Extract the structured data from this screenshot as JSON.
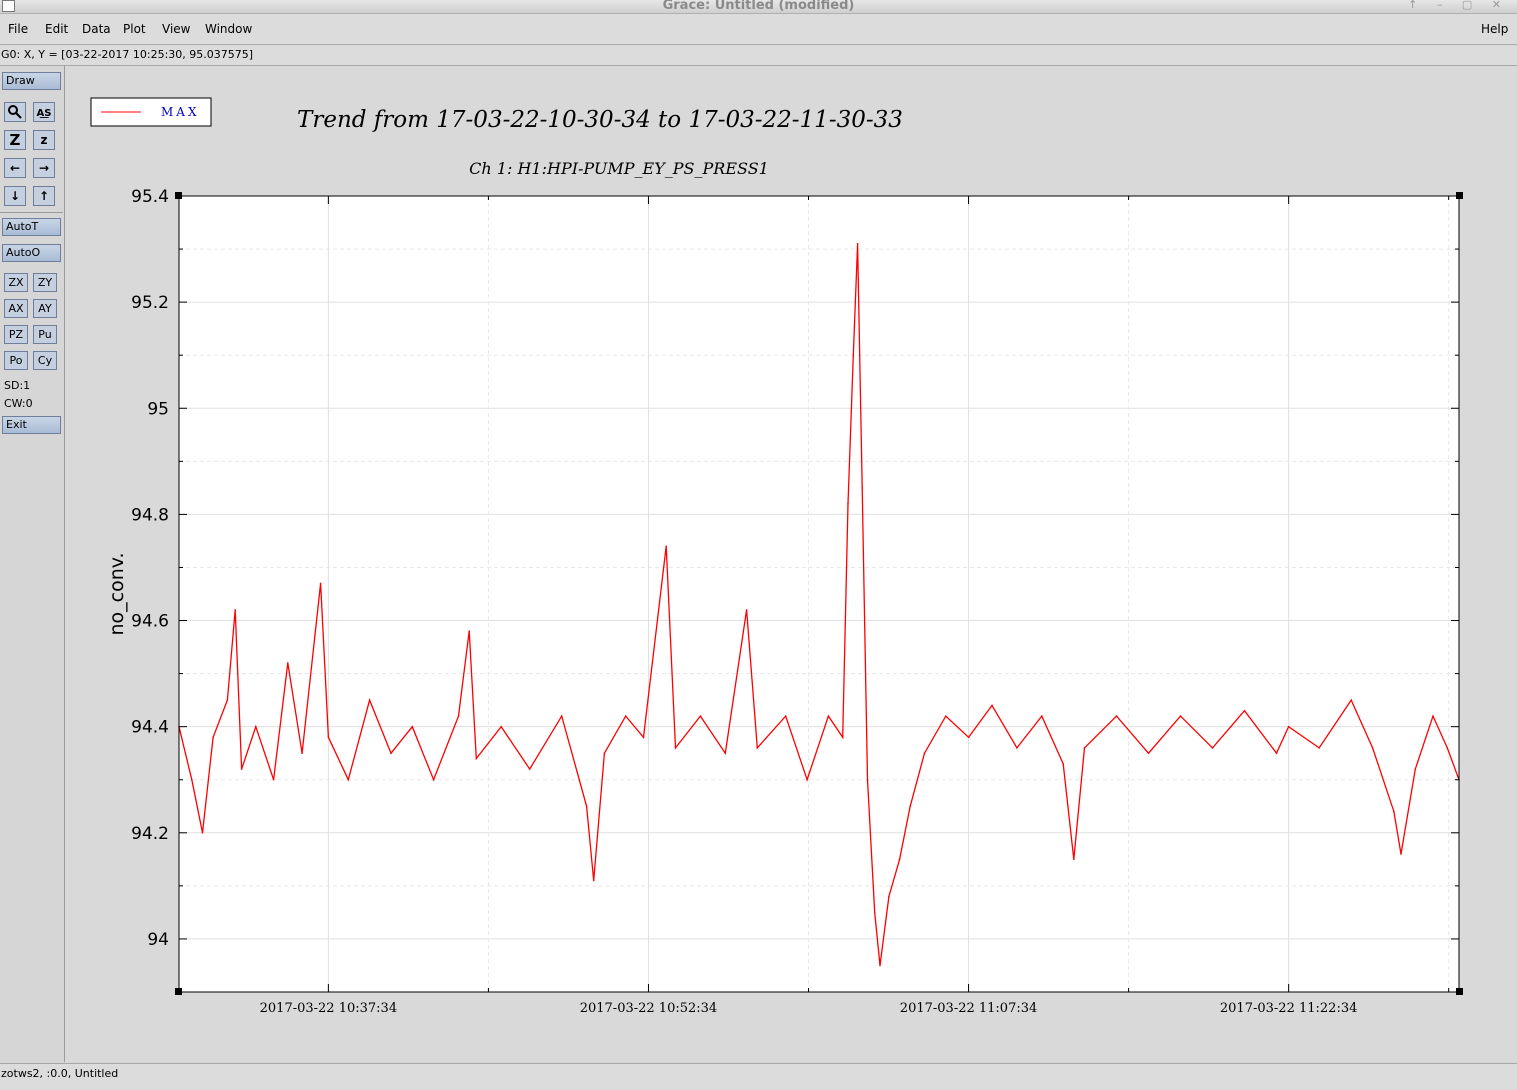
{
  "window": {
    "title": "Grace: Untitled (modified)"
  },
  "menu": [
    "File",
    "Edit",
    "Data",
    "Plot",
    "View",
    "Window"
  ],
  "help": "Help",
  "locator": "G0: X, Y = [03-22-2017 10:25:30, 95.037575]",
  "toolbox": {
    "draw": "Draw",
    "autot": "AutoT",
    "autoo": "AutoO",
    "small": [
      "ZX",
      "ZY",
      "AX",
      "AY",
      "PZ",
      "Pu",
      "Po",
      "Cy"
    ],
    "sd": "SD:1",
    "cw": "CW:0",
    "exit": "Exit"
  },
  "status": "zotws2, :0.0, Untitled",
  "chart_data": {
    "type": "line",
    "title": "Trend from 17-03-22-10-30-34 to 17-03-22-11-30-33",
    "subtitle": "Ch 1: H1:HPI-PUMP_EY_PS_PRESS1",
    "xlabel": "",
    "ylabel": "no_conv.",
    "xlim": [
      "2017-03-22 10:30:34",
      "2017-03-22 11:30:33"
    ],
    "ylim": [
      93.9,
      95.4
    ],
    "yticks": [
      94,
      94.2,
      94.4,
      94.6,
      94.8,
      95,
      95.2,
      95.4
    ],
    "xticks": [
      "2017-03-22 10:37:34",
      "2017-03-22 10:52:34",
      "2017-03-22 11:07:34",
      "2017-03-22 11:22:34"
    ],
    "grid": true,
    "legend_position": "top-left",
    "series": [
      {
        "name": "MAX",
        "color": "#ff0000",
        "points": [
          [
            "2017-03-22 10:30:34",
            94.4
          ],
          [
            "2017-03-22 10:31:10",
            94.3
          ],
          [
            "2017-03-22 10:31:40",
            94.2
          ],
          [
            "2017-03-22 10:32:10",
            94.38
          ],
          [
            "2017-03-22 10:32:50",
            94.45
          ],
          [
            "2017-03-22 10:33:12",
            94.62
          ],
          [
            "2017-03-22 10:33:30",
            94.32
          ],
          [
            "2017-03-22 10:34:10",
            94.4
          ],
          [
            "2017-03-22 10:35:00",
            94.3
          ],
          [
            "2017-03-22 10:35:40",
            94.52
          ],
          [
            "2017-03-22 10:36:20",
            94.35
          ],
          [
            "2017-03-22 10:37:12",
            94.67
          ],
          [
            "2017-03-22 10:37:34",
            94.38
          ],
          [
            "2017-03-22 10:38:30",
            94.3
          ],
          [
            "2017-03-22 10:39:30",
            94.45
          ],
          [
            "2017-03-22 10:40:30",
            94.35
          ],
          [
            "2017-03-22 10:41:30",
            94.4
          ],
          [
            "2017-03-22 10:42:30",
            94.3
          ],
          [
            "2017-03-22 10:43:40",
            94.42
          ],
          [
            "2017-03-22 10:44:10",
            94.58
          ],
          [
            "2017-03-22 10:44:30",
            94.34
          ],
          [
            "2017-03-22 10:45:40",
            94.4
          ],
          [
            "2017-03-22 10:47:00",
            94.32
          ],
          [
            "2017-03-22 10:48:30",
            94.42
          ],
          [
            "2017-03-22 10:49:40",
            94.25
          ],
          [
            "2017-03-22 10:50:00",
            94.11
          ],
          [
            "2017-03-22 10:50:30",
            94.35
          ],
          [
            "2017-03-22 10:51:30",
            94.42
          ],
          [
            "2017-03-22 10:52:20",
            94.38
          ],
          [
            "2017-03-22 10:53:24",
            94.74
          ],
          [
            "2017-03-22 10:53:50",
            94.36
          ],
          [
            "2017-03-22 10:55:00",
            94.42
          ],
          [
            "2017-03-22 10:56:10",
            94.35
          ],
          [
            "2017-03-22 10:57:10",
            94.62
          ],
          [
            "2017-03-22 10:57:40",
            94.36
          ],
          [
            "2017-03-22 10:59:00",
            94.42
          ],
          [
            "2017-03-22 11:00:00",
            94.3
          ],
          [
            "2017-03-22 11:01:00",
            94.42
          ],
          [
            "2017-03-22 11:01:40",
            94.38
          ],
          [
            "2017-03-22 11:01:55",
            94.82
          ],
          [
            "2017-03-22 11:02:10",
            95.1
          ],
          [
            "2017-03-22 11:02:22",
            95.31
          ],
          [
            "2017-03-22 11:02:35",
            94.85
          ],
          [
            "2017-03-22 11:02:50",
            94.3
          ],
          [
            "2017-03-22 11:03:10",
            94.05
          ],
          [
            "2017-03-22 11:03:25",
            93.95
          ],
          [
            "2017-03-22 11:03:50",
            94.08
          ],
          [
            "2017-03-22 11:04:20",
            94.15
          ],
          [
            "2017-03-22 11:04:50",
            94.25
          ],
          [
            "2017-03-22 11:05:30",
            94.35
          ],
          [
            "2017-03-22 11:06:30",
            94.42
          ],
          [
            "2017-03-22 11:07:34",
            94.38
          ],
          [
            "2017-03-22 11:08:40",
            94.44
          ],
          [
            "2017-03-22 11:09:50",
            94.36
          ],
          [
            "2017-03-22 11:11:00",
            94.42
          ],
          [
            "2017-03-22 11:12:00",
            94.33
          ],
          [
            "2017-03-22 11:12:30",
            94.15
          ],
          [
            "2017-03-22 11:13:00",
            94.36
          ],
          [
            "2017-03-22 11:14:30",
            94.42
          ],
          [
            "2017-03-22 11:16:00",
            94.35
          ],
          [
            "2017-03-22 11:17:30",
            94.42
          ],
          [
            "2017-03-22 11:19:00",
            94.36
          ],
          [
            "2017-03-22 11:20:30",
            94.43
          ],
          [
            "2017-03-22 11:22:00",
            94.35
          ],
          [
            "2017-03-22 11:22:34",
            94.4
          ],
          [
            "2017-03-22 11:24:00",
            94.36
          ],
          [
            "2017-03-22 11:25:30",
            94.45
          ],
          [
            "2017-03-22 11:26:30",
            94.36
          ],
          [
            "2017-03-22 11:27:30",
            94.24
          ],
          [
            "2017-03-22 11:27:50",
            94.16
          ],
          [
            "2017-03-22 11:28:30",
            94.32
          ],
          [
            "2017-03-22 11:29:20",
            94.42
          ],
          [
            "2017-03-22 11:30:00",
            94.36
          ],
          [
            "2017-03-22 11:30:33",
            94.3
          ]
        ]
      }
    ]
  }
}
